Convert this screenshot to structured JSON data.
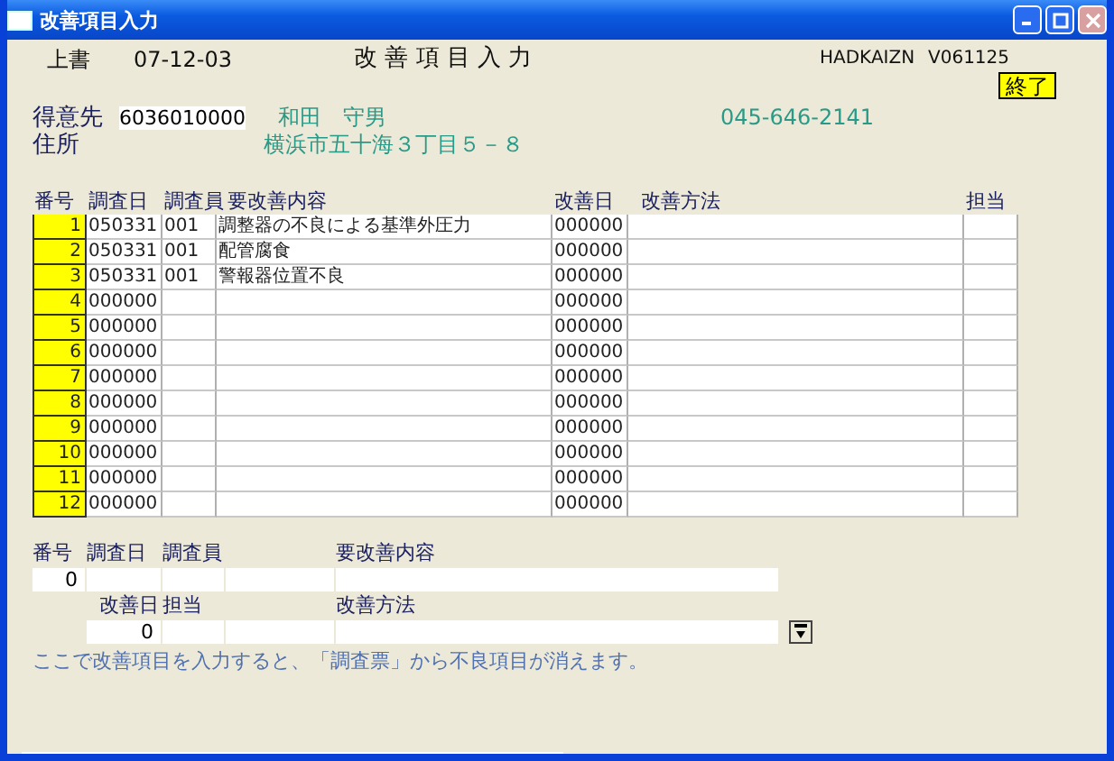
{
  "window": {
    "title": "改善項目入力"
  },
  "header": {
    "mode": "上書",
    "date": "07-12-03",
    "title": "改 善 項 目 入 力",
    "program_id": "HADKAIZN",
    "version": "V061125"
  },
  "exit_button": "終了",
  "customer": {
    "label": "得意先",
    "code": "6036010000",
    "name": "和田　守男",
    "phone": "045-646-2141",
    "address_label": "住所",
    "address": "横浜市五十海３丁目５－８"
  },
  "table": {
    "columns": [
      "番号",
      "調査日",
      "調査員",
      "要改善内容",
      "改善日",
      "改善方法",
      "担当"
    ],
    "rows": [
      {
        "no": "1",
        "survey_date": "050331",
        "surveyor": "001",
        "content": "調整器の不良による基準外圧力",
        "improve_date": "000000"
      },
      {
        "no": "2",
        "survey_date": "050331",
        "surveyor": "001",
        "content": "配管腐食",
        "improve_date": "000000"
      },
      {
        "no": "3",
        "survey_date": "050331",
        "surveyor": "001",
        "content": "警報器位置不良",
        "improve_date": "000000"
      },
      {
        "no": "4",
        "survey_date": "000000",
        "improve_date": "000000"
      },
      {
        "no": "5",
        "survey_date": "000000",
        "improve_date": "000000"
      },
      {
        "no": "6",
        "survey_date": "000000",
        "improve_date": "000000"
      },
      {
        "no": "7",
        "survey_date": "000000",
        "improve_date": "000000"
      },
      {
        "no": "8",
        "survey_date": "000000",
        "improve_date": "000000"
      },
      {
        "no": "9",
        "survey_date": "000000",
        "improve_date": "000000"
      },
      {
        "no": "10",
        "survey_date": "000000",
        "improve_date": "000000"
      },
      {
        "no": "11",
        "survey_date": "000000",
        "improve_date": "000000"
      },
      {
        "no": "12",
        "survey_date": "000000",
        "improve_date": "000000"
      }
    ]
  },
  "detail": {
    "labels_1": [
      "番号",
      "調査日",
      "調査員",
      "要改善内容"
    ],
    "no": "0",
    "labels_2": [
      "改善日",
      "担当",
      "改善方法"
    ],
    "improve_date": "0"
  },
  "help_text": "ここで改善項目を入力すると、「調査票」から不良項目が消えます。"
}
